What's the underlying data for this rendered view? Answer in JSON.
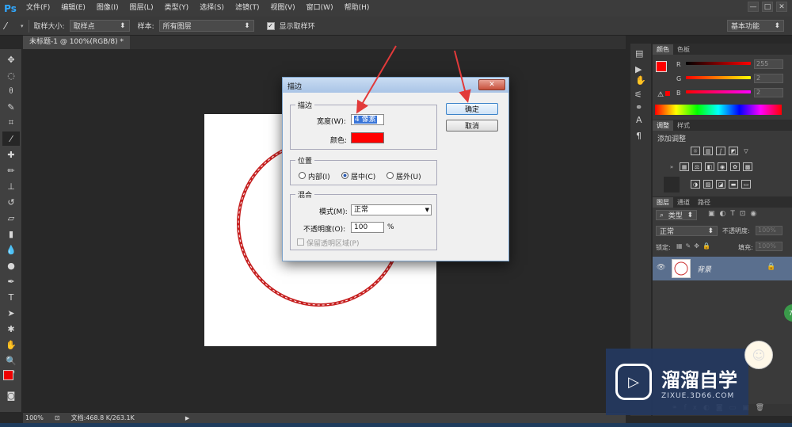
{
  "menubar": {
    "logo": "Ps",
    "items": [
      "文件(F)",
      "编辑(E)",
      "图像(I)",
      "图层(L)",
      "类型(Y)",
      "选择(S)",
      "滤镜(T)",
      "视图(V)",
      "窗口(W)",
      "帮助(H)"
    ]
  },
  "window_controls": [
    "—",
    "□",
    "✕"
  ],
  "options_bar": {
    "sample_size_label": "取样大小:",
    "sample_size_value": "取样点",
    "sample_label": "样本:",
    "sample_value": "所有图层",
    "show_ring_label": "显示取样环",
    "workspace_value": "基本功能"
  },
  "document_tab": "未标题-1 @ 100%(RGB/8) *",
  "status_bar": {
    "zoom": "100%",
    "doc_info": "文档:468.8 K/263.1K"
  },
  "color_panel": {
    "tabs": [
      "颜色",
      "色板"
    ],
    "channels": [
      {
        "label": "R",
        "value": "255"
      },
      {
        "label": "G",
        "value": "2"
      },
      {
        "label": "B",
        "value": "2"
      }
    ],
    "foreground": "#ff0202",
    "background": "#ffffff"
  },
  "adjustments_panel": {
    "tabs": [
      "调整",
      "样式"
    ],
    "title": "添加调整"
  },
  "layers_panel": {
    "tabs": [
      "图层",
      "通道",
      "路径"
    ],
    "kind_filter": "类型",
    "blend_mode": "正常",
    "opacity_label": "不透明度:",
    "opacity_value": "100%",
    "lock_label": "锁定:",
    "fill_label": "填充:",
    "fill_value": "100%",
    "layer_name": "背景"
  },
  "stroke_dialog": {
    "title": "描边",
    "stroke_group": "描边",
    "width_label": "宽度(W):",
    "width_value": "4 像素",
    "color_label": "颜色:",
    "stroke_color": "#ff0000",
    "position_group": "位置",
    "position_options": [
      "内部(I)",
      "居中(C)",
      "居外(U)"
    ],
    "position_selected_index": 1,
    "blend_group": "混合",
    "mode_label": "模式(M):",
    "mode_value": "正常",
    "opacity_label": "不透明度(O):",
    "opacity_value": "100",
    "opacity_unit": "%",
    "preserve_label": "保留透明区域(P)",
    "ok_label": "确定",
    "cancel_label": "取消"
  },
  "watermark": {
    "title": "溜溜自学",
    "url": "ZIXUE.3D66.COM"
  },
  "badge": "78",
  "colors": {
    "stroke_red": "#ff0000",
    "arrow_red": "#e23a3a",
    "dialog_border": "#7aa1c9",
    "selected_layer": "#5a6f8e"
  }
}
